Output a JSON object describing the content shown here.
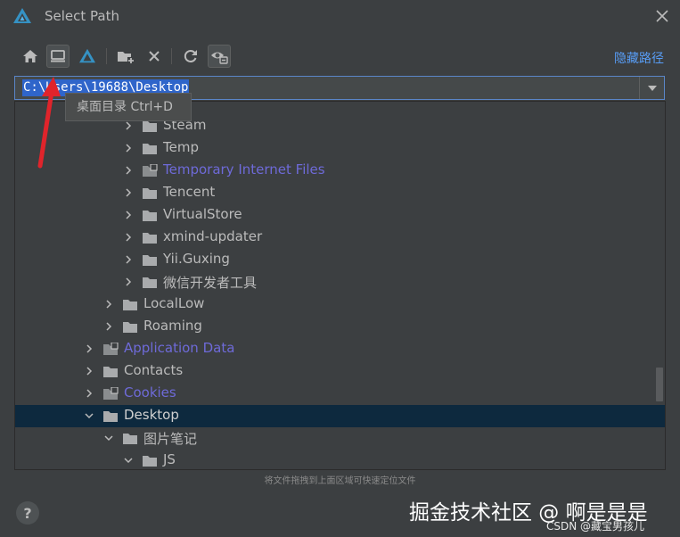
{
  "window": {
    "title": "Select Path"
  },
  "toolbar": {
    "buttons": [
      {
        "name": "home-button",
        "icon": "home-icon"
      },
      {
        "name": "desktop-button",
        "icon": "desktop-icon",
        "active": true
      },
      {
        "name": "project-button",
        "icon": "app-logo-icon"
      },
      {
        "name": "new-folder-button",
        "icon": "new-folder-icon"
      },
      {
        "name": "delete-button",
        "icon": "delete-icon"
      },
      {
        "name": "refresh-button",
        "icon": "refresh-icon"
      },
      {
        "name": "show-hidden-button",
        "icon": "eye-hidden-icon",
        "active": true
      }
    ],
    "hide_path_label": "隐藏路径"
  },
  "path": {
    "value": "C:\\Users\\19688\\Desktop"
  },
  "tooltip": {
    "text": "桌面目录  Ctrl+D"
  },
  "tree": [
    {
      "label": "Steam",
      "expanded": false,
      "link": false
    },
    {
      "label": "Temp",
      "expanded": false,
      "link": false
    },
    {
      "label": "Temporary Internet Files",
      "expanded": false,
      "link": true
    },
    {
      "label": "Tencent",
      "expanded": false,
      "link": false
    },
    {
      "label": "VirtualStore",
      "expanded": false,
      "link": false
    },
    {
      "label": "xmind-updater",
      "expanded": false,
      "link": false
    },
    {
      "label": "Yii.Guxing",
      "expanded": false,
      "link": false
    },
    {
      "label": "微信开发者工具",
      "expanded": false,
      "link": false
    },
    {
      "label": "LocalLow",
      "expanded": false,
      "link": false
    },
    {
      "label": "Roaming",
      "expanded": false,
      "link": false
    },
    {
      "label": "Application Data",
      "expanded": false,
      "link": true
    },
    {
      "label": "Contacts",
      "expanded": false,
      "link": false
    },
    {
      "label": "Cookies",
      "expanded": false,
      "link": true
    },
    {
      "label": "Desktop",
      "expanded": true,
      "link": false,
      "selected": true
    },
    {
      "label": "图片笔记",
      "expanded": true,
      "link": false
    },
    {
      "label": "JS",
      "expanded": true,
      "link": false
    }
  ],
  "hint": "将文件拖拽到上面区域可快速定位文件",
  "help": {
    "label": "?"
  },
  "watermark": {
    "main": "掘金技术社区 @ 啊是是是",
    "sub": "CSDN @藏宝男孩儿"
  },
  "colors": {
    "background": "#3c3f41",
    "selection": "#0d293e",
    "link_text": "#6e6ad8",
    "accent": "#589df6",
    "annotation_arrow": "#e0242b"
  }
}
